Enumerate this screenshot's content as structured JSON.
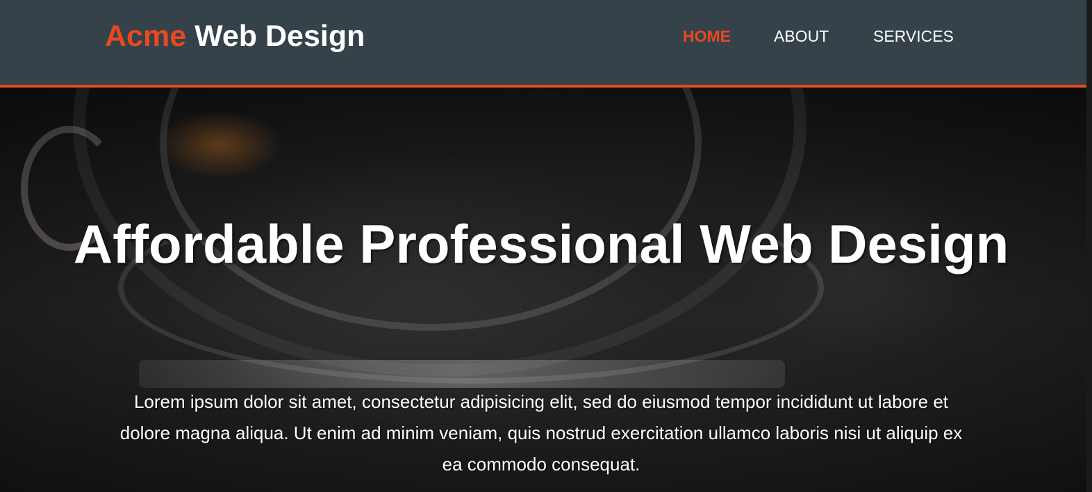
{
  "header": {
    "brand_highlight": "Acme",
    "brand_rest": " Web Design",
    "nav": [
      {
        "label": "HOME",
        "active": true
      },
      {
        "label": "ABOUT",
        "active": false
      },
      {
        "label": "SERVICES",
        "active": false
      }
    ]
  },
  "hero": {
    "title": "Affordable Professional Web Design",
    "body": "Lorem ipsum dolor sit amet, consectetur adipisicing elit, sed do eiusmod tempor incididunt ut labore et dolore magna aliqua. Ut enim ad minim veniam, quis nostrud exercitation ullamco laboris nisi ut aliquip ex ea commodo consequat."
  },
  "colors": {
    "header_bg": "#35424a",
    "accent": "#e8491d",
    "text": "#ffffff"
  }
}
